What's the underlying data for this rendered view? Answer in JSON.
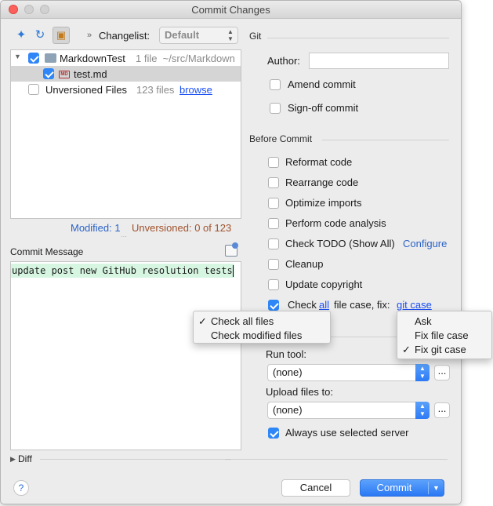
{
  "window": {
    "title": "Commit Changes"
  },
  "toolbar": {
    "changelist_label": "Changelist:",
    "changelist_value": "Default"
  },
  "tree": {
    "project": {
      "name": "MarkdownTest",
      "info": "1 file  ~/src/Markdown"
    },
    "file": {
      "badge": "MD",
      "name": "test.md"
    },
    "unversioned": {
      "name": "Unversioned Files",
      "count": "123 files",
      "link": "browse"
    }
  },
  "status": {
    "modified": "Modified: 1",
    "unversioned": "Unversioned: 0 of 123"
  },
  "commit_message": {
    "label": "Commit Message",
    "text": "update post new GitHub resolution tests"
  },
  "git": {
    "title": "Git",
    "author_label": "Author:",
    "author_value": "",
    "amend": "Amend commit",
    "signoff": "Sign-off commit"
  },
  "before_commit": {
    "title": "Before Commit",
    "reformat": "Reformat code",
    "rearrange": "Rearrange code",
    "optimize": "Optimize imports",
    "analysis": "Perform code analysis",
    "todo": "Check TODO (Show All)",
    "todo_link": "Configure",
    "cleanup": "Cleanup",
    "copyright": "Update copyright",
    "case_prefix": "Check",
    "case_scope": "all",
    "case_middle": "file case, fix:",
    "case_fix": "git case"
  },
  "scope_popup": {
    "items": [
      "Check all files",
      "Check modified files"
    ],
    "checkmark": "✓"
  },
  "fix_popup": {
    "items": [
      "Ask",
      "Fix file case",
      "Fix git case"
    ],
    "checkmark": "✓"
  },
  "deployment": {
    "run_tool_label": "Run tool:",
    "run_tool_value": "(none)",
    "upload_label": "Upload files to:",
    "upload_value": "(none)",
    "ellipsis": "...",
    "always_server": "Always use selected server"
  },
  "diff": {
    "label": "Diff"
  },
  "buttons": {
    "help": "?",
    "cancel": "Cancel",
    "commit": "Commit"
  },
  "colors": {
    "accent": "#2f86f6",
    "modified": "#2a63c8",
    "unversioned": "#a0522d",
    "commit_highlight": "#d7f6e2"
  }
}
